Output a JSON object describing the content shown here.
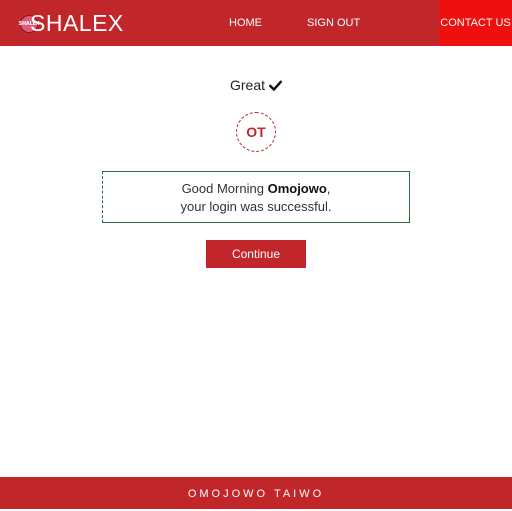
{
  "header": {
    "logo_badge_text": "SHALEX",
    "brand": "SHALEX",
    "nav": {
      "home": "HOME",
      "sign_out": "SIGN OUT",
      "contact": "CONTACT US"
    }
  },
  "main": {
    "status": "Great",
    "status_icon": "check-icon",
    "avatar_initials": "OT",
    "greeting_prefix": "Good Morning",
    "user_name": "Omojowo",
    "greeting_suffix": ",",
    "login_message": "your login was successful.",
    "continue_label": "Continue"
  },
  "footer": {
    "name": "OMOJOWO TAIWO"
  },
  "colors": {
    "primary_red": "#c1262b",
    "contact_red": "#ee0f0f",
    "box_border": "#2f6b3a"
  }
}
